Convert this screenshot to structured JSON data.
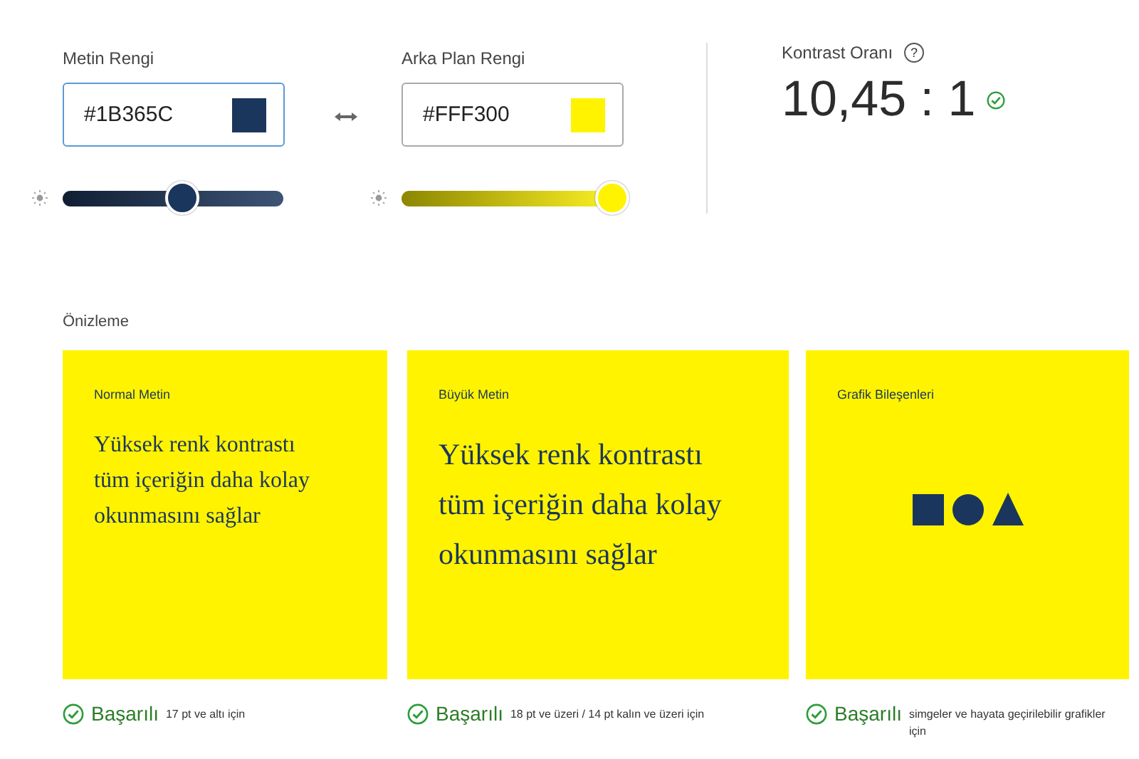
{
  "pickers": [
    {
      "label": "Metin Rengi",
      "value": "#1B365C",
      "focused": true,
      "slider": {
        "level": 0.53
      }
    },
    {
      "label": "Arka Plan Rengi",
      "value": "#FFF300",
      "focused": false,
      "slider": {
        "level": 1.0
      }
    }
  ],
  "contrast": {
    "label": "Kontrast Oranı",
    "help": "?",
    "ratio": "10,45 : 1",
    "passed": true
  },
  "preview": {
    "label": "Önizleme",
    "cards": [
      {
        "kind": "normal-text",
        "title": "Normal Metin",
        "body": "Yüksek renk kontrastı tüm içeriğin daha kolay okunmasını sağlar",
        "result": {
          "passed": true,
          "status": "Başarılı",
          "note": "17 pt ve altı için"
        }
      },
      {
        "kind": "large-text",
        "title": "Büyük Metin",
        "body": "Yüksek renk kontrastı tüm içeriğin daha kolay okunmasını sağlar",
        "result": {
          "passed": true,
          "status": "Başarılı",
          "note": "18 pt ve üzeri / 14 pt kalın ve üzeri için"
        }
      },
      {
        "kind": "graphics",
        "title": "Grafik Bileşenleri",
        "result": {
          "passed": true,
          "status": "Başarılı",
          "note": "simgeler ve hayata geçirilebilir grafikler için"
        }
      }
    ]
  }
}
